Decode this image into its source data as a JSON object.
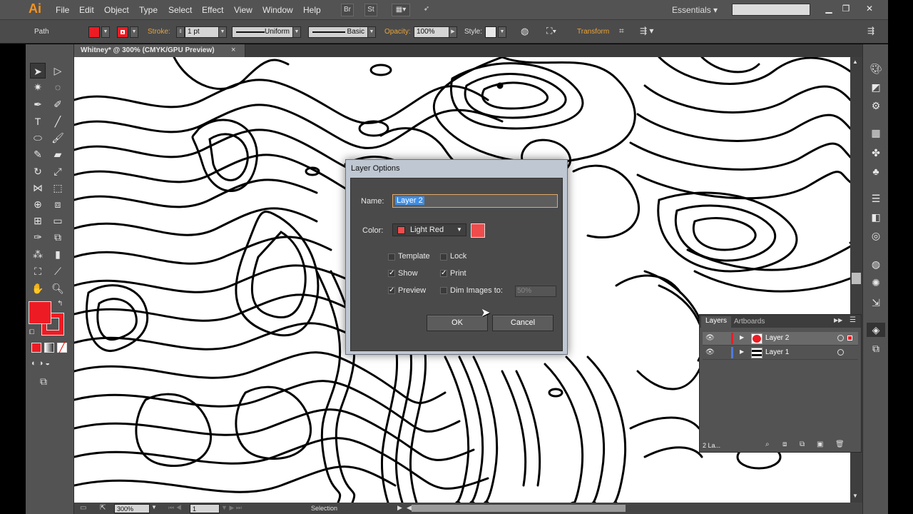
{
  "app": {
    "logo": "Ai"
  },
  "menu": [
    "File",
    "Edit",
    "Object",
    "Type",
    "Select",
    "Effect",
    "View",
    "Window",
    "Help"
  ],
  "menubar_buttons": {
    "br": "Br",
    "st": "St"
  },
  "workspace": {
    "label": "Essentials"
  },
  "control_bar": {
    "selection_type": "Path",
    "stroke_label": "Stroke:",
    "stroke_weight": "1 pt",
    "profile_uniform": "Uniform",
    "brush_basic": "Basic",
    "opacity_label": "Opacity:",
    "opacity_value": "100%",
    "style_label": "Style:",
    "transform_label": "Transform"
  },
  "document_tab": {
    "title": "Whitney* @ 300% (CMYK/GPU Preview)",
    "close": "×"
  },
  "status_bar": {
    "zoom": "300%",
    "artboard": "1",
    "mode": "Selection"
  },
  "dialog": {
    "title": "Layer Options",
    "name_label": "Name:",
    "name_value": "Layer 2",
    "color_label": "Color:",
    "color_value": "Light Red",
    "color_hex": "#ef4c4c",
    "template_label": "Template",
    "lock_label": "Lock",
    "show_label": "Show",
    "print_label": "Print",
    "preview_label": "Preview",
    "dim_label": "Dim Images to:",
    "dim_value": "50%",
    "checks": {
      "template": false,
      "lock": false,
      "show": true,
      "print": true,
      "preview": true,
      "dim": false
    },
    "ok_label": "OK",
    "cancel_label": "Cancel"
  },
  "layers_panel": {
    "tab_layers": "Layers",
    "tab_artboards": "Artboards",
    "layers": [
      {
        "name": "Layer 2",
        "color": "#ed1c24"
      },
      {
        "name": "Layer 1",
        "color": "#4f7bde"
      }
    ],
    "count_label": "2 La..."
  },
  "colors": {
    "fill": "#ed1c24",
    "stroke": "#ed1c24",
    "ui_dark": "#535353"
  }
}
